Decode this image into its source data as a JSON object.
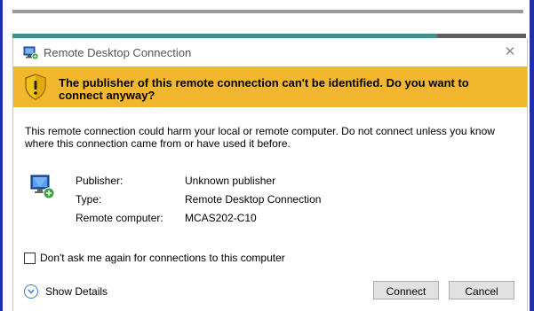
{
  "dialog": {
    "title": "Remote Desktop Connection",
    "close_glyph": "✕",
    "warning": "The publisher of this remote connection can't be identified. Do you want to connect anyway?",
    "description": "This remote connection could harm your local or remote computer. Do not connect unless you know where this connection came from or have used it before.",
    "details": [
      {
        "label": "Publisher:",
        "value": "Unknown publisher"
      },
      {
        "label": "Type:",
        "value": "Remote Desktop Connection"
      },
      {
        "label": "Remote computer:",
        "value": "MCAS202-C10"
      }
    ],
    "checkbox_label": "Don't ask me again for connections to this computer",
    "checkbox_checked": false,
    "show_details_label": "Show Details",
    "buttons": {
      "connect": "Connect",
      "cancel": "Cancel"
    }
  },
  "icons": {
    "app": "remote-desktop-icon",
    "warning": "shield-warning-icon",
    "computer": "computer-icon",
    "expand": "chevron-down-icon",
    "close": "close-icon"
  },
  "colors": {
    "banner": "#f3b72f",
    "window_border": "#1f2fa8",
    "button_bg": "#e1e1e1"
  }
}
